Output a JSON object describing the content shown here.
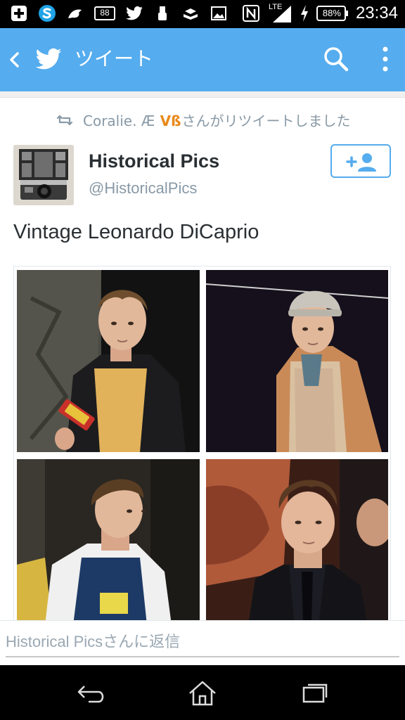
{
  "status_bar": {
    "time": "23:34",
    "battery": "88%",
    "notification_count": "88",
    "network": "LTE",
    "icons": [
      "plus-notification-icon",
      "skype-icon",
      "dolphin-icon",
      "mail-count-icon",
      "twitter-icon",
      "usb-icon",
      "tray-icon",
      "gallery-icon",
      "nfc-icon",
      "signal-icon",
      "charging-icon",
      "battery-icon"
    ]
  },
  "app_bar": {
    "title": "ツイート",
    "background": "#55acee",
    "icons": [
      "back-icon",
      "twitter-bird-icon",
      "search-icon",
      "overflow-menu-icon"
    ]
  },
  "tweet": {
    "retweeted_by": {
      "user": "Coralie. Æ",
      "mark": "Vß",
      "suffix": "さんがリツイートしました",
      "icon": "retweet-icon"
    },
    "author": {
      "display_name": "Historical Pics",
      "handle": "@HistoricalPics",
      "avatar": "avatar-camera-film"
    },
    "follow_button": {
      "icon": "add-user-icon",
      "color": "#55acee"
    },
    "text": "Vintage Leonardo DiCaprio",
    "media": [
      {
        "name": "photo-1"
      },
      {
        "name": "photo-2"
      },
      {
        "name": "photo-3"
      },
      {
        "name": "photo-4"
      }
    ]
  },
  "reply": {
    "placeholder": "Historical Picsさんに返信"
  },
  "nav_bar": {
    "icons": [
      "nav-back-icon",
      "nav-home-icon",
      "nav-recents-icon"
    ]
  },
  "colors": {
    "accent": "#55acee",
    "primary_text": "#292f33",
    "secondary_text": "#8899a6",
    "retweet_mark": "#e88a1a"
  }
}
